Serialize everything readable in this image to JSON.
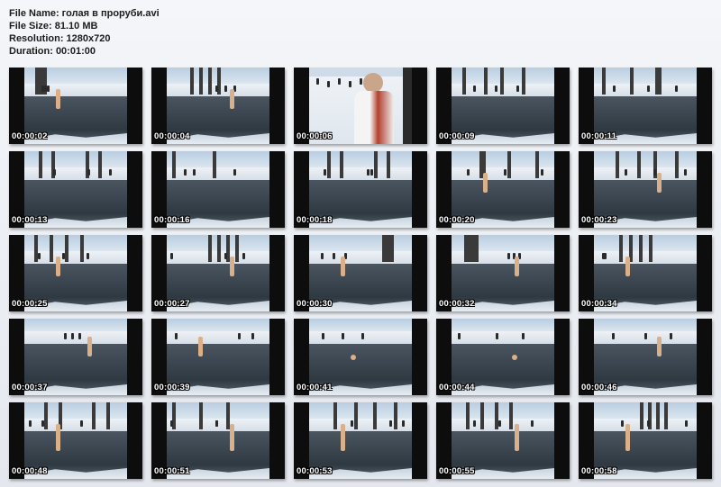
{
  "header": {
    "file_name": "File Name: голая в проруби.avi",
    "file_size": "File Size: 81.10 MB",
    "resolution": "Resolution: 1280x720",
    "duration": "Duration: 00:01:00"
  },
  "thumbnails": [
    {
      "timestamp": "00:00:02",
      "scene": "shore"
    },
    {
      "timestamp": "00:00:04",
      "scene": "wade"
    },
    {
      "timestamp": "00:00:06",
      "scene": "closeup"
    },
    {
      "timestamp": "00:00:09",
      "scene": "hole"
    },
    {
      "timestamp": "00:00:11",
      "scene": "hole"
    },
    {
      "timestamp": "00:00:13",
      "scene": "hole"
    },
    {
      "timestamp": "00:00:16",
      "scene": "hole"
    },
    {
      "timestamp": "00:00:18",
      "scene": "hole"
    },
    {
      "timestamp": "00:00:20",
      "scene": "wade"
    },
    {
      "timestamp": "00:00:23",
      "scene": "wade"
    },
    {
      "timestamp": "00:00:25",
      "scene": "wade"
    },
    {
      "timestamp": "00:00:27",
      "scene": "wade"
    },
    {
      "timestamp": "00:00:30",
      "scene": "wade"
    },
    {
      "timestamp": "00:00:32",
      "scene": "wade"
    },
    {
      "timestamp": "00:00:34",
      "scene": "wade"
    },
    {
      "timestamp": "00:00:37",
      "scene": "open"
    },
    {
      "timestamp": "00:00:39",
      "scene": "open"
    },
    {
      "timestamp": "00:00:41",
      "scene": "swim"
    },
    {
      "timestamp": "00:00:44",
      "scene": "swim"
    },
    {
      "timestamp": "00:00:46",
      "scene": "open"
    },
    {
      "timestamp": "00:00:48",
      "scene": "exit"
    },
    {
      "timestamp": "00:00:51",
      "scene": "exit"
    },
    {
      "timestamp": "00:00:53",
      "scene": "exit"
    },
    {
      "timestamp": "00:00:55",
      "scene": "exit"
    },
    {
      "timestamp": "00:00:58",
      "scene": "exit"
    }
  ]
}
